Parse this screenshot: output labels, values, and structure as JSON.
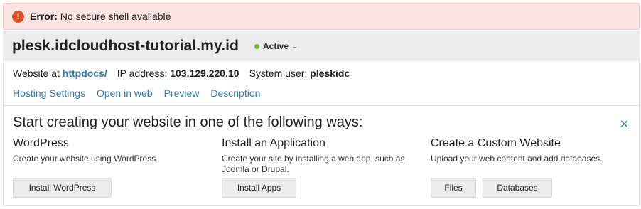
{
  "error": {
    "label": "Error:",
    "message": "No secure shell available",
    "icon": "exclamation-icon",
    "color": "#e0541f"
  },
  "domain": {
    "name": "plesk.idcloudhost-tutorial.my.id",
    "status": "Active",
    "status_color": "#7cb342"
  },
  "info": {
    "website_prefix": "Website at",
    "website_link": "httpdocs/",
    "ip_label": "IP address:",
    "ip_value": "103.129.220.10",
    "user_label": "System user:",
    "user_value": "pleskidc"
  },
  "nav_links": [
    "Hosting Settings",
    "Open in web",
    "Preview",
    "Description"
  ],
  "start": {
    "title": "Start creating your website in one of the following ways:",
    "close_icon": "close-icon",
    "columns": [
      {
        "title": "WordPress",
        "desc": "Create your website using WordPress.",
        "buttons": [
          "Install WordPress"
        ]
      },
      {
        "title": "Install an Application",
        "desc": "Create your site by installing a web app, such as Joomla or Drupal.",
        "buttons": [
          "Install Apps"
        ]
      },
      {
        "title": "Create a Custom Website",
        "desc": "Upload your web content and add databases.",
        "buttons": [
          "Files",
          "Databases"
        ]
      }
    ]
  },
  "colors": {
    "link": "#2b7bb9",
    "error_bg": "#fbe3e3",
    "header_bg": "#ececec"
  }
}
